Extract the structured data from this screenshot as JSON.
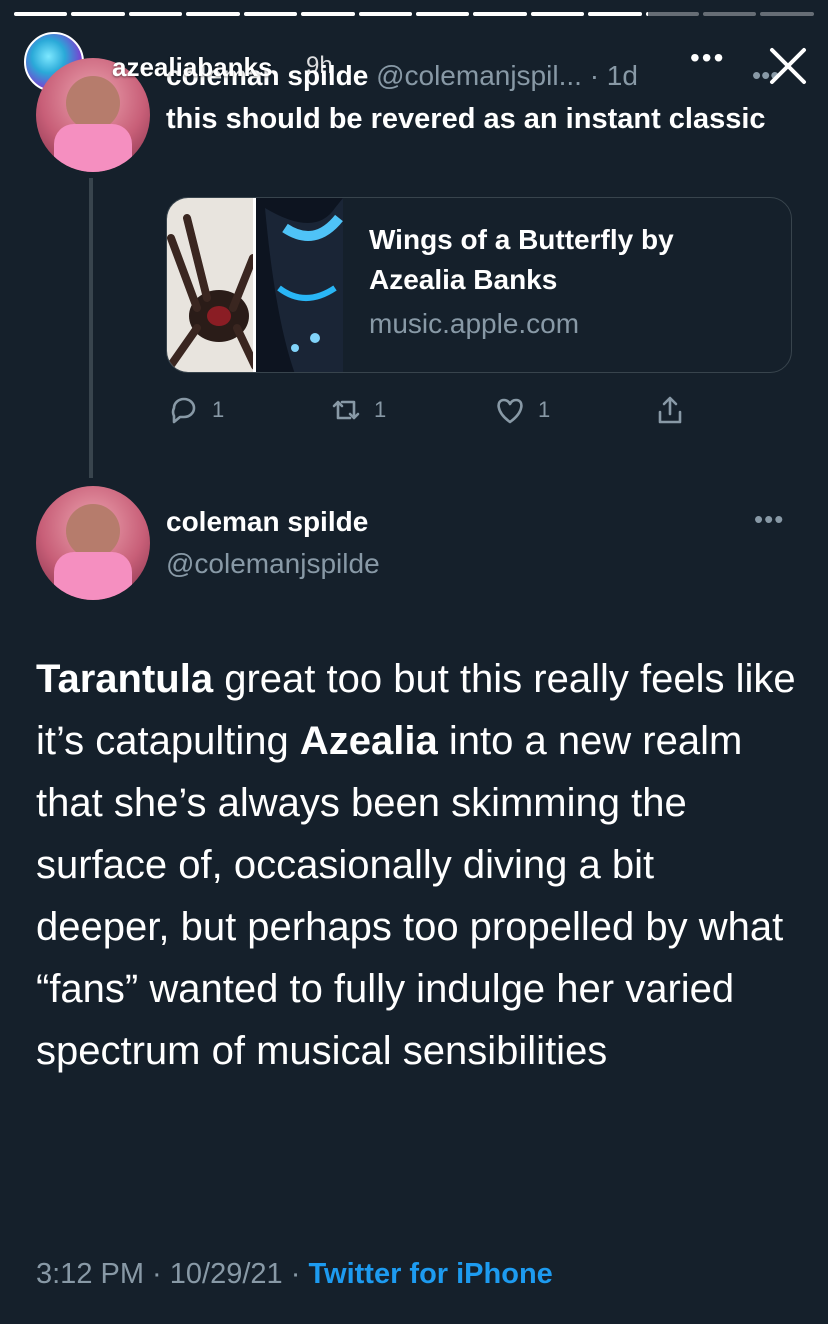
{
  "story": {
    "progress": [
      1,
      1,
      1,
      1,
      1,
      1,
      1,
      1,
      1,
      1,
      1,
      0.05,
      0,
      0
    ],
    "username": "azealiabanks",
    "time": "9h",
    "more": "•••"
  },
  "tweet1": {
    "name": "coleman spilde",
    "handle": "@colemanjspil...",
    "time": "· 1d",
    "more": "•••",
    "text": "this should be revered as an instant classic",
    "card": {
      "title": "Wings of a Butterfly by Azealia Banks",
      "domain": "music.apple.com"
    },
    "actions": {
      "replies": "1",
      "retweets": "1",
      "likes": "1"
    }
  },
  "tweet2": {
    "name": "coleman spilde",
    "handle": "@colemanjspilde",
    "more": "•••",
    "body": [
      {
        "text": "Tarantula",
        "bold": true
      },
      {
        "text": " great too but this really feels like it’s catapulting ",
        "bold": false
      },
      {
        "text": "Azealia",
        "bold": true
      },
      {
        "text": " into a new realm that she’s always been skimming the surface of, occasionally diving a bit deeper, but perhaps too propelled by what “fans” wanted to fully indulge her varied spectrum of musical sensibilities",
        "bold": false
      }
    ],
    "time": "3:12 PM",
    "date": "10/29/21",
    "separator": " · ",
    "source": "Twitter for iPhone"
  }
}
